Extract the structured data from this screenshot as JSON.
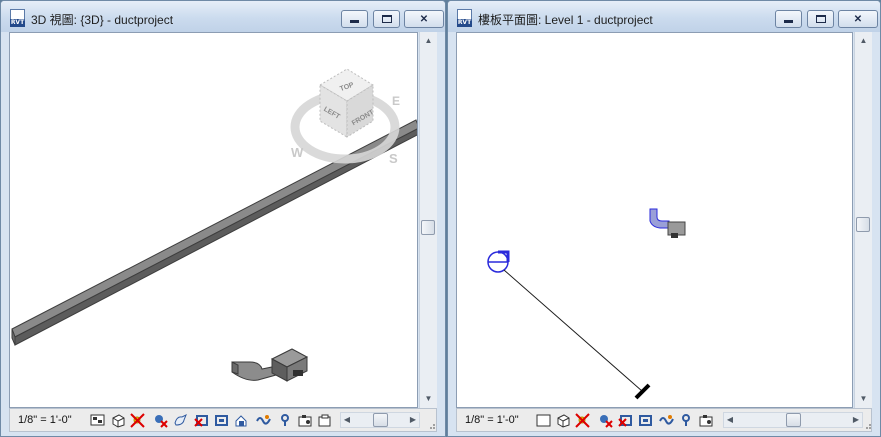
{
  "window_3d": {
    "title": "3D 視圖: {3D} - ductproject",
    "file_icon_label": "RVT",
    "view_cube": {
      "top": "TOP",
      "left": "LEFT",
      "front": "FRONT",
      "compass_w": "W",
      "compass_s": "S",
      "compass_e": "E"
    },
    "scale": "1/8\" = 1'-0\""
  },
  "window_plan": {
    "title": "樓板平面圖: Level 1 - ductproject",
    "file_icon_label": "RVT",
    "scale": "1/8\" = 1'-0\""
  },
  "window_buttons": {
    "minimize": "",
    "maximize": "",
    "close": "✕"
  },
  "scroll_arrows": {
    "up": "▲",
    "down": "▼",
    "left": "◀",
    "right": "▶"
  },
  "colors": {
    "duct": "#8a8a8a",
    "duct_dark": "#4e4e4e",
    "plan_blue": "#2a2adb",
    "titlebar": "#cbdbee"
  }
}
